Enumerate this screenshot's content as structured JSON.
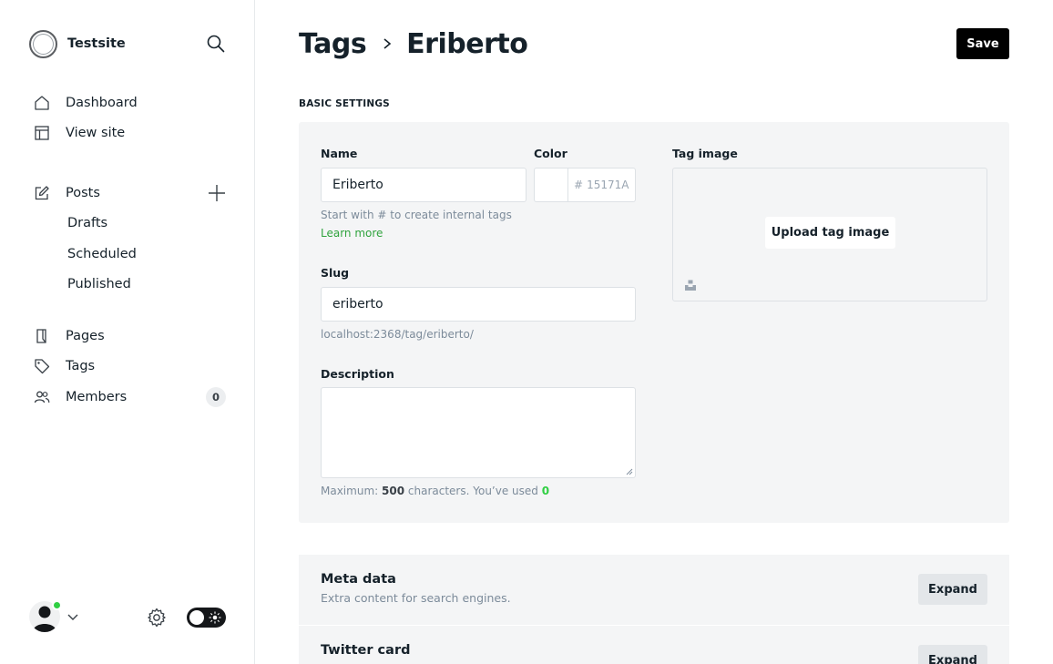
{
  "site": {
    "name": "Testsite"
  },
  "nav": {
    "dashboard": "Dashboard",
    "view_site": "View site",
    "posts": "Posts",
    "drafts": "Drafts",
    "scheduled": "Scheduled",
    "published": "Published",
    "pages": "Pages",
    "tags": "Tags",
    "members": "Members",
    "members_count": "0"
  },
  "header": {
    "breadcrumb_parent": "Tags",
    "breadcrumb_current": "Eriberto",
    "save_label": "Save"
  },
  "basic": {
    "section_title": "BASIC SETTINGS",
    "name_label": "Name",
    "name_value": "Eriberto",
    "color_label": "Color",
    "color_hash": "#",
    "color_placeholder": "15171A",
    "name_hint": "Start with # to create internal tags",
    "learn_more": "Learn more",
    "slug_label": "Slug",
    "slug_value": "eriberto",
    "slug_url": "localhost:2368/tag/eriberto/",
    "description_label": "Description",
    "desc_hint_prefix": "Maximum:",
    "desc_max": "500",
    "desc_hint_middle": "characters. You’ve used",
    "desc_used": "0",
    "tag_image_label": "Tag image",
    "upload_label": "Upload tag image"
  },
  "meta": {
    "title": "Meta data",
    "subtitle": "Extra content for search engines.",
    "expand": "Expand"
  },
  "twitter": {
    "title": "Twitter card",
    "expand": "Expand"
  },
  "colors": {
    "accent_green": "#30a33e",
    "online_green": "#30cf43",
    "save_bg": "#000000"
  }
}
